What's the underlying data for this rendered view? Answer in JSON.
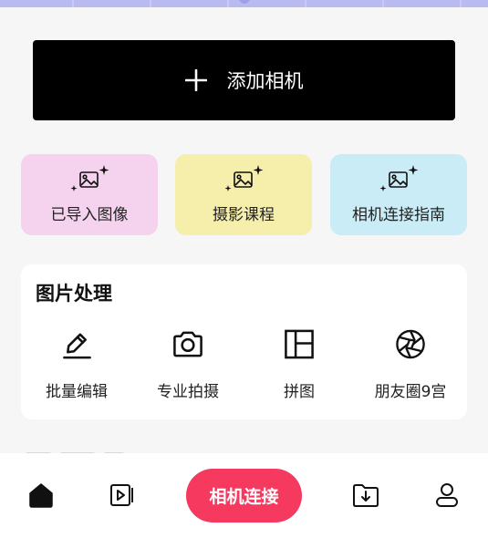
{
  "add_camera": {
    "label": "添加相机"
  },
  "quick_actions": [
    {
      "label": "已导入图像",
      "bg": "#f5d3ee",
      "icon": "image-sparkle-icon"
    },
    {
      "label": "摄影课程",
      "bg": "#f6eeab",
      "icon": "image-sparkle-icon"
    },
    {
      "label": "相机连接指南",
      "bg": "#c9ecf6",
      "icon": "image-sparkle-icon"
    }
  ],
  "image_processing": {
    "title": "图片处理",
    "tools": [
      {
        "label": "批量编辑",
        "icon": "pencil-icon"
      },
      {
        "label": "专业拍摄",
        "icon": "camera-icon"
      },
      {
        "label": "拼图",
        "icon": "collage-icon"
      },
      {
        "label": "朋友圈9宫",
        "icon": "aperture-icon"
      }
    ]
  },
  "bottom_nav": {
    "connect_label": "相机连接",
    "items": [
      "home-icon",
      "video-icon",
      "folder-download-icon",
      "user-icon"
    ]
  },
  "colors": {
    "accent": "#f5395f",
    "top_strip": "#b9bbf0"
  }
}
